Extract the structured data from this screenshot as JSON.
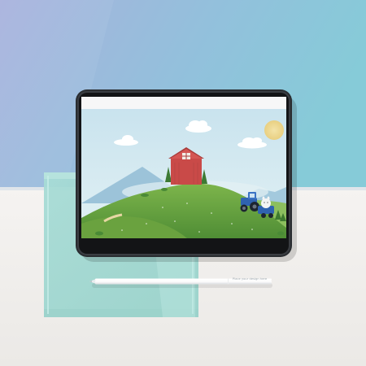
{
  "stylus": {
    "engraving": "Place your design here"
  },
  "colors": {
    "wall_top": "#a9b6dd",
    "wall_right": "#86c6d8",
    "floor": "#f1efec",
    "glass_sleeve": "#a6d7d2",
    "sky": "#cfe8f1",
    "hill": "#6ea843",
    "barn": "#c94a48",
    "tractor": "#2f63b0",
    "sun": "#f4d98a"
  },
  "icons": [
    "tablet",
    "stylus",
    "glass-sleeve",
    "barn",
    "tractor",
    "sun",
    "clouds",
    "mountains",
    "hills"
  ]
}
